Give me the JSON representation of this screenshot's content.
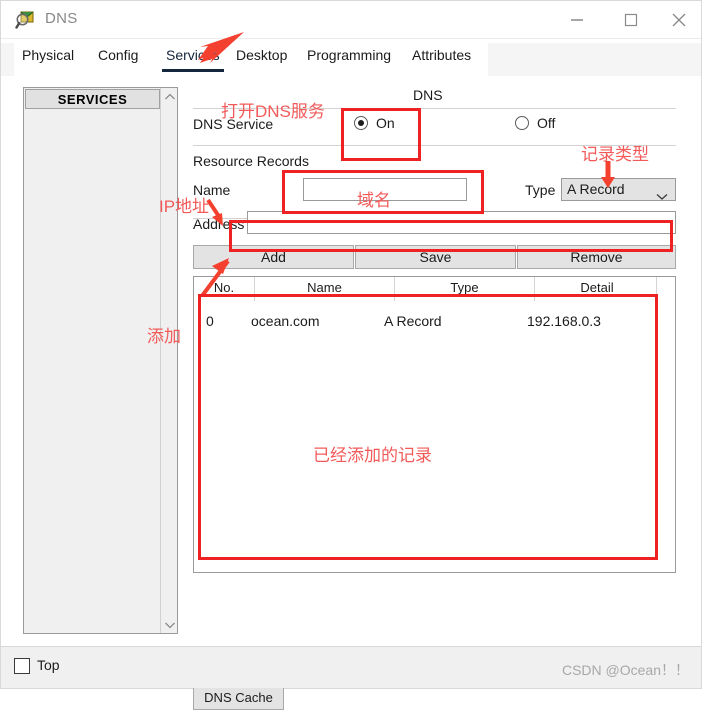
{
  "window": {
    "title": "DNS",
    "icon": "dns-magnifier-icon",
    "controls": {
      "minimize": "minimize-icon",
      "maximize": "maximize-icon",
      "close": "close-icon"
    }
  },
  "tabs": [
    {
      "label": "Physical",
      "active": false
    },
    {
      "label": "Config",
      "active": false
    },
    {
      "label": "Services",
      "active": true
    },
    {
      "label": "Desktop",
      "active": false
    },
    {
      "label": "Programming",
      "active": false
    },
    {
      "label": "Attributes",
      "active": false
    }
  ],
  "sidebar": {
    "header": "SERVICES",
    "items": []
  },
  "dns_panel": {
    "group_title": "DNS",
    "service_label": "DNS Service",
    "radio_on": "On",
    "radio_off": "Off",
    "service_state": "On",
    "resource_records_label": "Resource Records",
    "name_label": "Name",
    "name_value": "",
    "name_placeholder": "",
    "type_label": "Type",
    "type_value": "A Record",
    "address_label": "Address",
    "address_value": "",
    "address_placeholder": "",
    "buttons": {
      "add": "Add",
      "save": "Save",
      "remove": "Remove",
      "dns_cache": "DNS Cache"
    }
  },
  "records_table": {
    "columns": [
      "No.",
      "Name",
      "Type",
      "Detail"
    ],
    "rows": [
      {
        "no": "0",
        "name": "ocean.com",
        "type": "A Record",
        "detail": "192.168.0.3"
      }
    ]
  },
  "footer": {
    "top_checkbox_label": "Top",
    "top_checked": false,
    "watermark": "CSDN @Ocean！！"
  },
  "annotations": {
    "accent_color": "#ee2222",
    "text_color": "#f25a5a",
    "labels": {
      "open_dns_service": "打开DNS服务",
      "record_type": "记录类型",
      "domain_name": "域名",
      "ip_address": "IP地址",
      "add": "添加",
      "added_records": "已经添加的记录"
    }
  }
}
